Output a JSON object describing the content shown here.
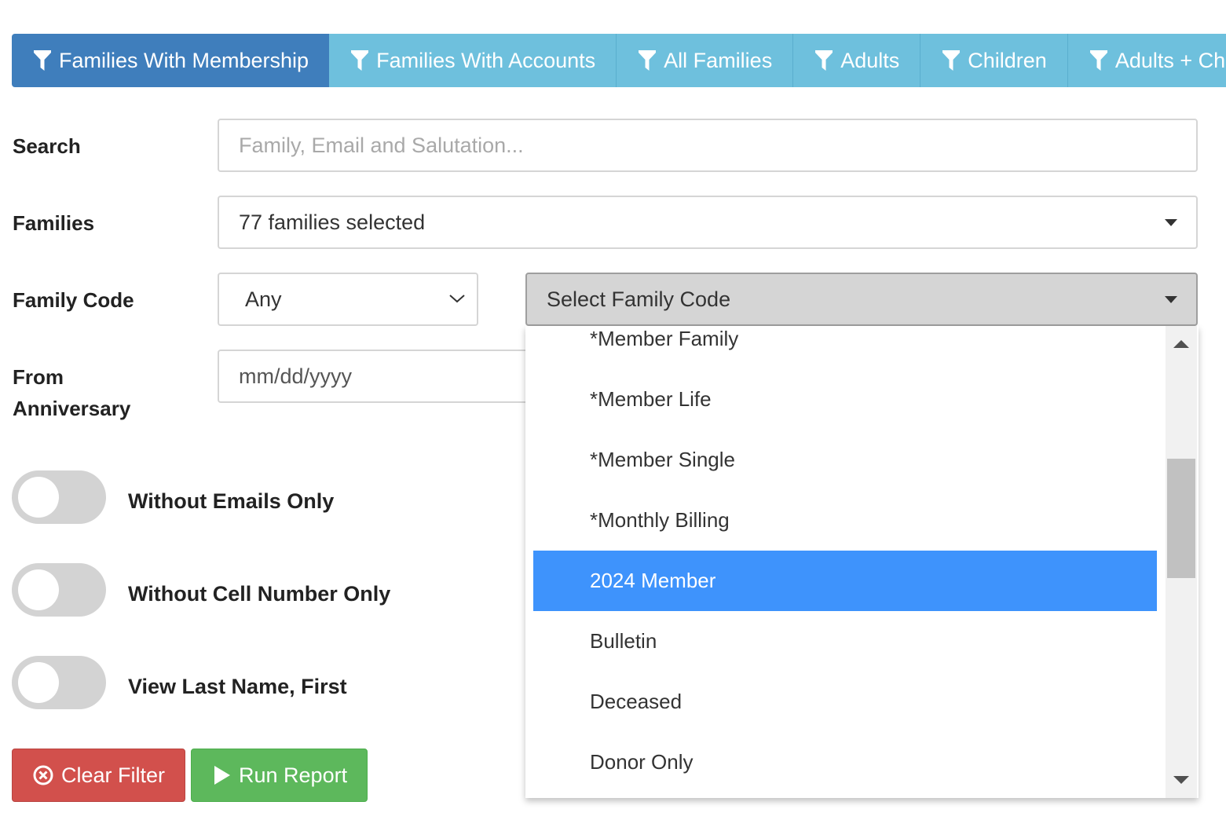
{
  "tabs": [
    {
      "label": "Families With Membership",
      "active": true
    },
    {
      "label": "Families With Accounts",
      "active": false
    },
    {
      "label": "All Families",
      "active": false
    },
    {
      "label": "Adults",
      "active": false
    },
    {
      "label": "Children",
      "active": false
    },
    {
      "label": "Adults + Children",
      "active": false
    }
  ],
  "search": {
    "label": "Search",
    "placeholder": "Family, Email and Salutation..."
  },
  "families": {
    "label": "Families",
    "value": "77 families selected"
  },
  "family_code": {
    "label": "Family Code",
    "operator": "Any",
    "select_label": "Select Family Code"
  },
  "from_anniversary": {
    "label_line1": "From",
    "label_line2": "Anniversary",
    "placeholder": "mm/dd/yyyy"
  },
  "family_code_options": [
    {
      "label": "*Member Family",
      "selected": false
    },
    {
      "label": "*Member Life",
      "selected": false
    },
    {
      "label": "*Member Single",
      "selected": false
    },
    {
      "label": "*Monthly Billing",
      "selected": false
    },
    {
      "label": "2024 Member",
      "selected": true
    },
    {
      "label": "Bulletin",
      "selected": false
    },
    {
      "label": "Deceased",
      "selected": false
    },
    {
      "label": "Donor Only",
      "selected": false
    }
  ],
  "toggles": [
    {
      "label": "Without Emails Only",
      "on": false
    },
    {
      "label": "Without Cell Number Only",
      "on": false
    },
    {
      "label": "View Last Name, First",
      "on": false
    }
  ],
  "buttons": {
    "clear_label": "Clear Filter",
    "run_label": "Run Report"
  },
  "colors": {
    "tab_active": "#3f7ebc",
    "tab_inactive": "#6ec0dd",
    "option_selected": "#3e93fc",
    "clear_button": "#d2504c",
    "run_button": "#5db85c"
  },
  "icons": {
    "tab": "funnel-icon",
    "clear": "times-circle-icon",
    "run": "play-icon"
  }
}
